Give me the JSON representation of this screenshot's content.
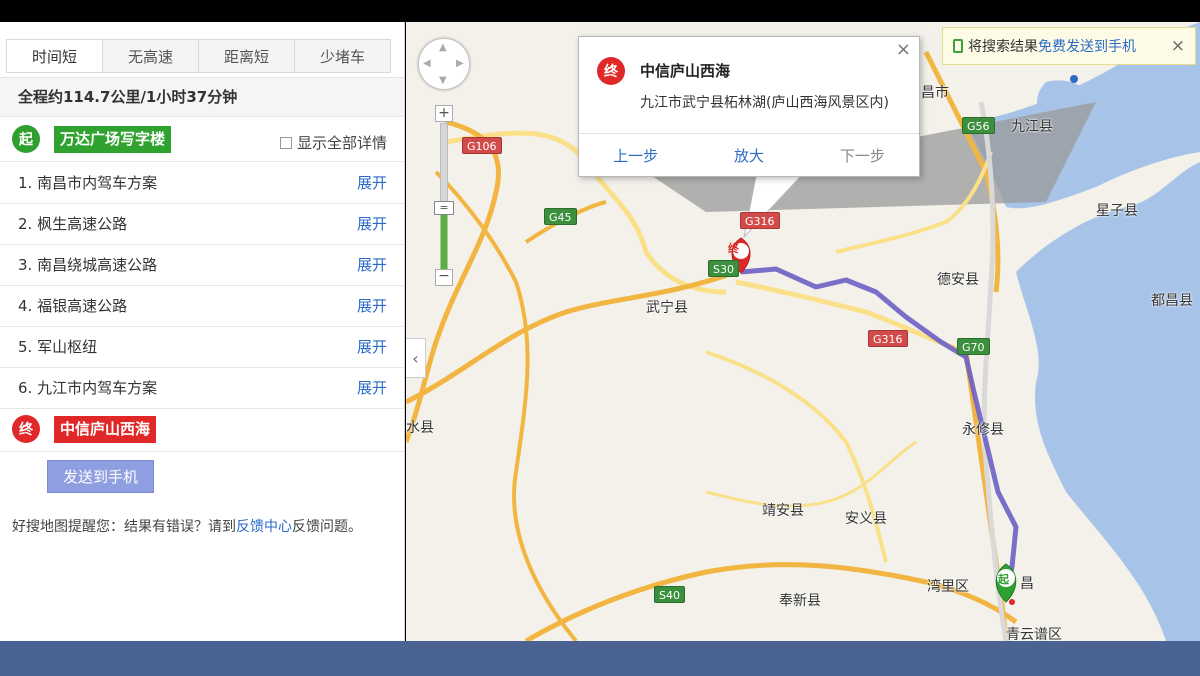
{
  "route_tabs": [
    "时间短",
    "无高速",
    "距离短",
    "少堵车"
  ],
  "summary": "全程约114.7公里/1小时37分钟",
  "start": {
    "badge": "起",
    "name": "万达广场写字楼"
  },
  "show_all_details_label": "显示全部详情",
  "steps": [
    {
      "text": "1. 南昌市内驾车方案",
      "action": "展开"
    },
    {
      "text": "2. 枫生高速公路",
      "action": "展开"
    },
    {
      "text": "3. 南昌绕城高速公路",
      "action": "展开"
    },
    {
      "text": "4. 福银高速公路",
      "action": "展开"
    },
    {
      "text": "5. 军山枢纽",
      "action": "展开"
    },
    {
      "text": "6. 九江市内驾车方案",
      "action": "展开"
    }
  ],
  "end": {
    "badge": "终",
    "name": "中信庐山西海"
  },
  "send_to_phone_label": "发送到手机",
  "feedback": {
    "prefix": "好搜地图提醒您：结果有错误？请到",
    "link": "反馈中心",
    "suffix": "反馈问题。"
  },
  "map": {
    "collapse_icon": "‹",
    "zoom_in_label": "+",
    "zoom_out_label": "−",
    "zoom_level_fraction": 0.45,
    "zoom_handle_label": "=",
    "close_symbol": "×",
    "popup": {
      "badge": "终",
      "title": "中信庐山西海",
      "address": "九江市武宁县柘林湖(庐山西海风景区内)",
      "actions": [
        "上一步",
        "放大",
        "下一步"
      ]
    },
    "send_result": {
      "prefix": "将搜索结果",
      "link": "免费发送到手机"
    },
    "place_labels": [
      "武宁县",
      "德安县",
      "星子县",
      "都昌县",
      "九江县",
      "永修县",
      "靖安县",
      "安义县",
      "奉新县",
      "湾里区",
      "青云谱区",
      "昌市",
      "水县",
      "昌"
    ],
    "road_shields": [
      "G106",
      "G45",
      "G316",
      "S30",
      "G316",
      "G70",
      "S40",
      "G56"
    ],
    "marker_start": "起",
    "marker_end": "终",
    "colors": {
      "route": "#6b5fc4",
      "water": "#a7c4e8",
      "highway": "#f2b541",
      "road": "#fbe08a",
      "start_green": "#2fa02f",
      "end_red": "#e02828"
    }
  }
}
